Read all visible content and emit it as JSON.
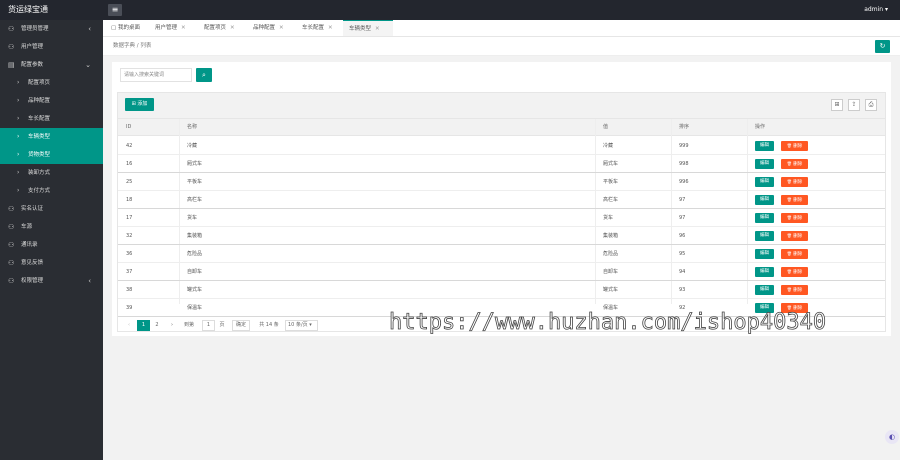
{
  "app": {
    "title": "货运绿宝通",
    "user": "admin"
  },
  "sidebar": {
    "items": [
      {
        "icon": "user-icon",
        "label": "管理员管理",
        "arrow": "‹"
      },
      {
        "icon": "user-icon",
        "label": "用户管理",
        "arrow": ""
      },
      {
        "icon": "settings-icon",
        "label": "配置参数",
        "arrow": "⌄"
      },
      {
        "icon": "chevron-right-icon",
        "label": "配置项页",
        "arrow": ""
      },
      {
        "icon": "chevron-right-icon",
        "label": "品种配置",
        "arrow": ""
      },
      {
        "icon": "chevron-right-icon",
        "label": "车长配置",
        "arrow": ""
      },
      {
        "icon": "chevron-right-icon",
        "label": "车辆类型",
        "arrow": ""
      },
      {
        "icon": "chevron-right-icon",
        "label": "货物类型",
        "arrow": ""
      },
      {
        "icon": "chevron-right-icon",
        "label": "装卸方式",
        "arrow": ""
      },
      {
        "icon": "chevron-right-icon",
        "label": "支付方式",
        "arrow": ""
      },
      {
        "icon": "user-icon",
        "label": "实名认证",
        "arrow": ""
      },
      {
        "icon": "user-icon",
        "label": "车源",
        "arrow": ""
      },
      {
        "icon": "user-icon",
        "label": "通讯录",
        "arrow": ""
      },
      {
        "icon": "user-icon",
        "label": "意见反馈",
        "arrow": ""
      },
      {
        "icon": "user-icon",
        "label": "权限管理",
        "arrow": "‹"
      }
    ]
  },
  "tabs": [
    {
      "label": "我的桌面",
      "close": ""
    },
    {
      "label": "用户管理",
      "close": "✕"
    },
    {
      "label": "配置项页",
      "close": "✕"
    },
    {
      "label": "品种配置",
      "close": "✕"
    },
    {
      "label": "车长配置",
      "close": "✕"
    },
    {
      "label": "车辆类型",
      "close": "✕"
    }
  ],
  "breadcrumb": {
    "home": "数据字典",
    "sep": "/",
    "current": "列表"
  },
  "search": {
    "placeholder": "请输入搜索关键词",
    "icon": "search-icon"
  },
  "toolbar": {
    "add_label": "添加",
    "icons": [
      "filter-icon",
      "export-icon",
      "print-icon"
    ]
  },
  "table": {
    "headers": [
      "ID",
      "名称",
      "值",
      "排序",
      "操作"
    ],
    "rows": [
      {
        "id": "42",
        "name": "冷藏",
        "value": "冷藏",
        "sort": "999"
      },
      {
        "id": "16",
        "name": "厢式车",
        "value": "厢式车",
        "sort": "998"
      },
      {
        "id": "25",
        "name": "平板车",
        "value": "平板车",
        "sort": "996"
      },
      {
        "id": "18",
        "name": "高栏车",
        "value": "高栏车",
        "sort": "97"
      },
      {
        "id": "17",
        "name": "货车",
        "value": "货车",
        "sort": "97"
      },
      {
        "id": "32",
        "name": "集装箱",
        "value": "集装箱",
        "sort": "96"
      },
      {
        "id": "36",
        "name": "危险品",
        "value": "危险品",
        "sort": "95"
      },
      {
        "id": "37",
        "name": "自卸车",
        "value": "自卸车",
        "sort": "94"
      },
      {
        "id": "38",
        "name": "罐式车",
        "value": "罐式车",
        "sort": "93"
      },
      {
        "id": "39",
        "name": "保温车",
        "value": "保温车",
        "sort": "92"
      }
    ],
    "edit_label": "编辑",
    "delete_label": "删除"
  },
  "pager": {
    "prev": "‹",
    "pages": [
      "1",
      "2"
    ],
    "next": "›",
    "goto_label": "到第",
    "goto_value": "1",
    "page_unit": "页",
    "confirm_label": "确定",
    "total_label": "共 14 条",
    "page_size": "10 条/页 ▾"
  },
  "watermark": "https://www.huzhan.com/ishop40340",
  "colors": {
    "primary": "#009688",
    "danger": "#ff5722",
    "sidebar": "#2a2d33",
    "header": "#23262e"
  }
}
